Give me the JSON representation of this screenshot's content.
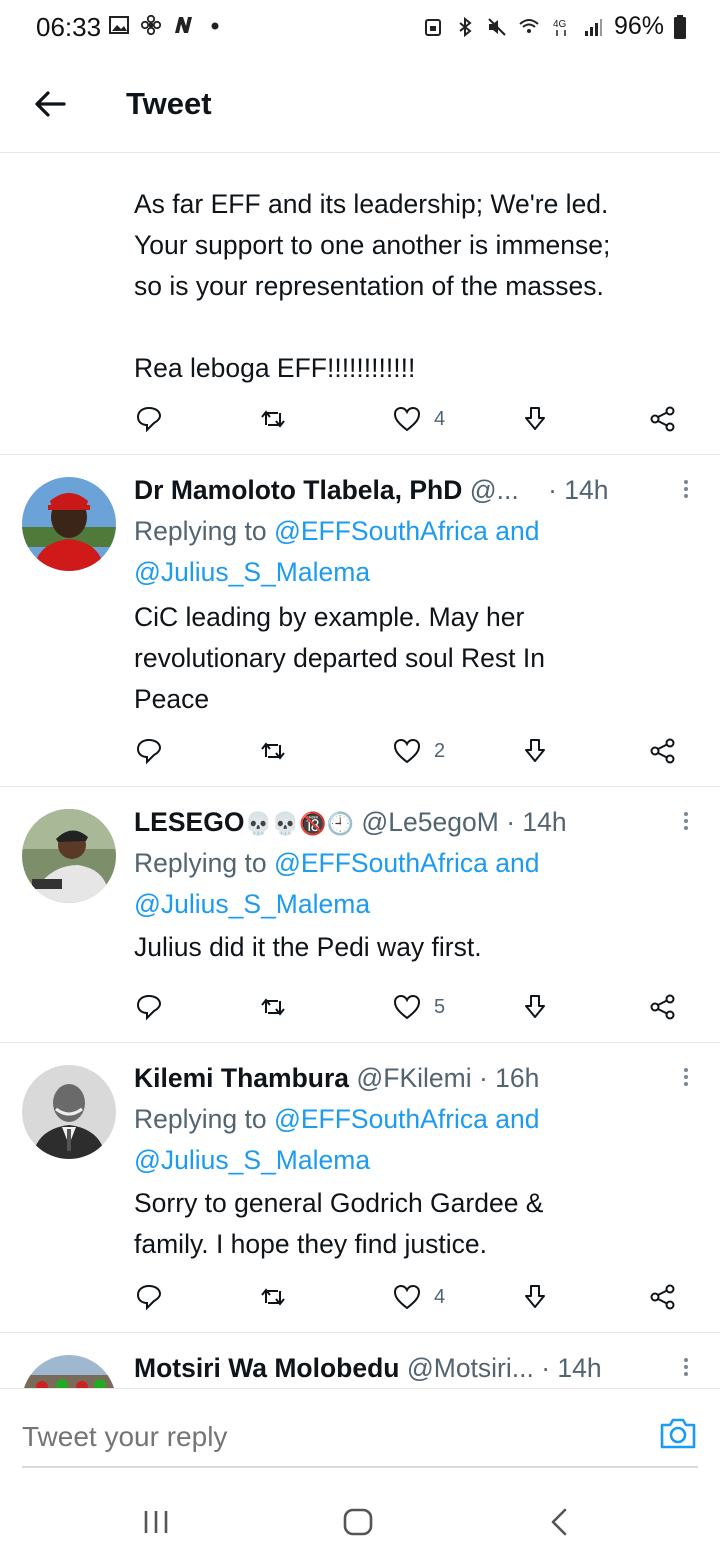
{
  "status_bar": {
    "time": "06:33",
    "battery": "96%",
    "left_icons": [
      "gallery-icon",
      "fan-icon",
      "n-app-icon",
      "dot-icon"
    ],
    "right_icons": [
      "lock-icon",
      "bluetooth-icon",
      "mute-icon",
      "wifi-icon",
      "4g-icon",
      "signal-icon",
      "battery-icon"
    ]
  },
  "header": {
    "title": "Tweet"
  },
  "colors": {
    "link": "#1d9bf0",
    "muted": "#536471",
    "text": "#0f1419"
  },
  "tweets": [
    {
      "text": "As far EFF and its leadership; We're led.\nYour support to one another is immense;\nso is your representation of the masses.\n\nRea leboga EFF!!!!!!!!!!!!",
      "likes": "4"
    },
    {
      "author": "Dr Mamoloto Tlabela, PhD",
      "handle": "@...",
      "time": "· 14h",
      "replying_prefix": "Replying to ",
      "replying_to": "@EFFSouthAfrica and",
      "replying_to2": "@Julius_S_Malema",
      "text": "CiC leading by example. May her\nrevolutionary departed soul Rest In\nPeace",
      "likes": "2"
    },
    {
      "author": "LESEGO",
      "author_emojis": "💀💀🔞🕘",
      "handle": "@Le5egoM",
      "time": "· 14h",
      "replying_prefix": "Replying to ",
      "replying_to": "@EFFSouthAfrica and",
      "replying_to2": "@Julius_S_Malema",
      "text": "Julius did it the Pedi way first.",
      "likes": "5"
    },
    {
      "author": "Kilemi Thambura",
      "handle": "@FKilemi",
      "time": "· 16h",
      "replying_prefix": "Replying to ",
      "replying_to": "@EFFSouthAfrica and",
      "replying_to2": "@Julius_S_Malema",
      "text": "Sorry to general Godrich Gardee &\nfamily. I hope they find justice.",
      "likes": "4"
    },
    {
      "author": "Motsiri Wa Molobedu",
      "handle": "@Motsiri...",
      "time": "· 14h"
    }
  ],
  "composer": {
    "placeholder": "Tweet your reply"
  }
}
